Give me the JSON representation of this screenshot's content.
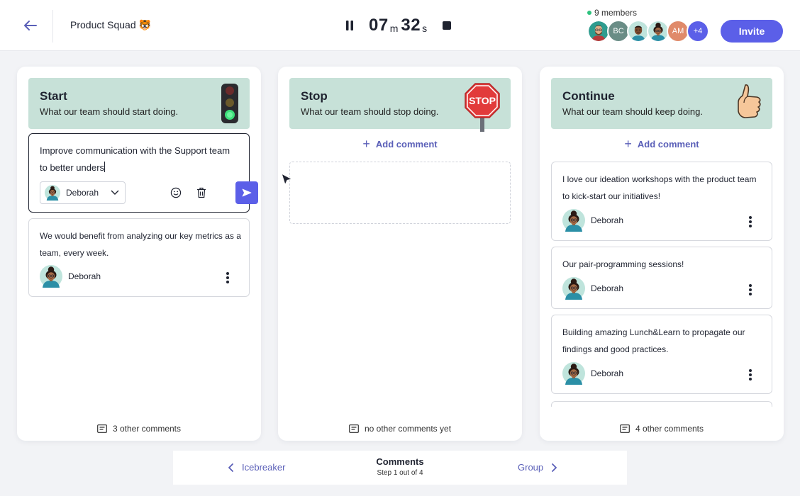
{
  "header": {
    "squad_name": "Product Squad 🐯",
    "timer": {
      "minutes": "07",
      "minutes_unit": "m",
      "seconds": "32",
      "seconds_unit": "s"
    },
    "members_label": "9 members",
    "avatars": [
      {
        "kind": "illustration",
        "name": "member-1"
      },
      {
        "kind": "initials",
        "initials": "BC",
        "color": "#6a8d86"
      },
      {
        "kind": "illustration",
        "name": "member-3"
      },
      {
        "kind": "illustration",
        "name": "member-4"
      },
      {
        "kind": "initials",
        "initials": "AM",
        "color": "#e08a6a"
      },
      {
        "kind": "more",
        "label": "+4",
        "color": "#5b5fe8"
      }
    ],
    "invite_label": "Invite"
  },
  "colors": {
    "accent": "#5b5fe8",
    "column_header": "#c7e1d8",
    "link": "#5a5fb8",
    "online": "#2ec27e"
  },
  "columns": {
    "start": {
      "title": "Start",
      "subtitle": "What our team should start doing.",
      "illustration": "traffic-light",
      "draft": {
        "text": "Improve communication with the Support team to better unders",
        "author": "Deborah"
      },
      "comments": [
        {
          "text": "We would benefit from analyzing our key metrics as a team, every week.",
          "author": "Deborah"
        }
      ],
      "footer": "3 other comments"
    },
    "stop": {
      "title": "Stop",
      "subtitle": "What our team should stop doing.",
      "illustration": "stop-sign",
      "sign_text": "STOP",
      "add_comment_label": "Add comment",
      "footer": "no other comments yet"
    },
    "continue": {
      "title": "Continue",
      "subtitle": "What our team should keep doing.",
      "illustration": "thumbs-up",
      "add_comment_label": "Add comment",
      "comments": [
        {
          "text": "I love our ideation workshops with the product team to kick-start our initiatives!",
          "author": "Deborah"
        },
        {
          "text": "Our pair-programming sessions!",
          "author": "Deborah"
        },
        {
          "text": "Building amazing Lunch&Learn to propagate our findings and good practices.",
          "author": "Deborah"
        }
      ],
      "footer": "4 other comments"
    }
  },
  "bottom_nav": {
    "prev_label": "Icebreaker",
    "current_title": "Comments",
    "current_step": "Step 1 out of 4",
    "next_label": "Group"
  }
}
